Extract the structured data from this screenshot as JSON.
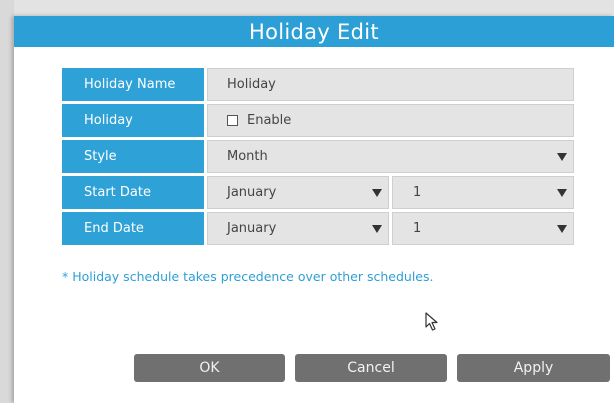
{
  "dialog": {
    "title": "Holiday Edit",
    "accent_color": "#2b9fd6"
  },
  "form": {
    "holiday_name": {
      "label": "Holiday Name",
      "value": "Holiday"
    },
    "holiday_enable": {
      "label": "Holiday",
      "checkbox_label": "Enable",
      "checked": false
    },
    "style": {
      "label": "Style",
      "value": "Month"
    },
    "start_date": {
      "label": "Start Date",
      "month": "January",
      "day": "1"
    },
    "end_date": {
      "label": "End Date",
      "month": "January",
      "day": "1"
    }
  },
  "note": "* Holiday schedule takes precedence over other schedules.",
  "buttons": {
    "ok": "OK",
    "cancel": "Cancel",
    "apply": "Apply",
    "button_color": "#707070"
  },
  "icons": {
    "dropdown": "chevron-down-icon",
    "checkbox": "checkbox-icon",
    "cursor": "mouse-pointer-icon"
  }
}
